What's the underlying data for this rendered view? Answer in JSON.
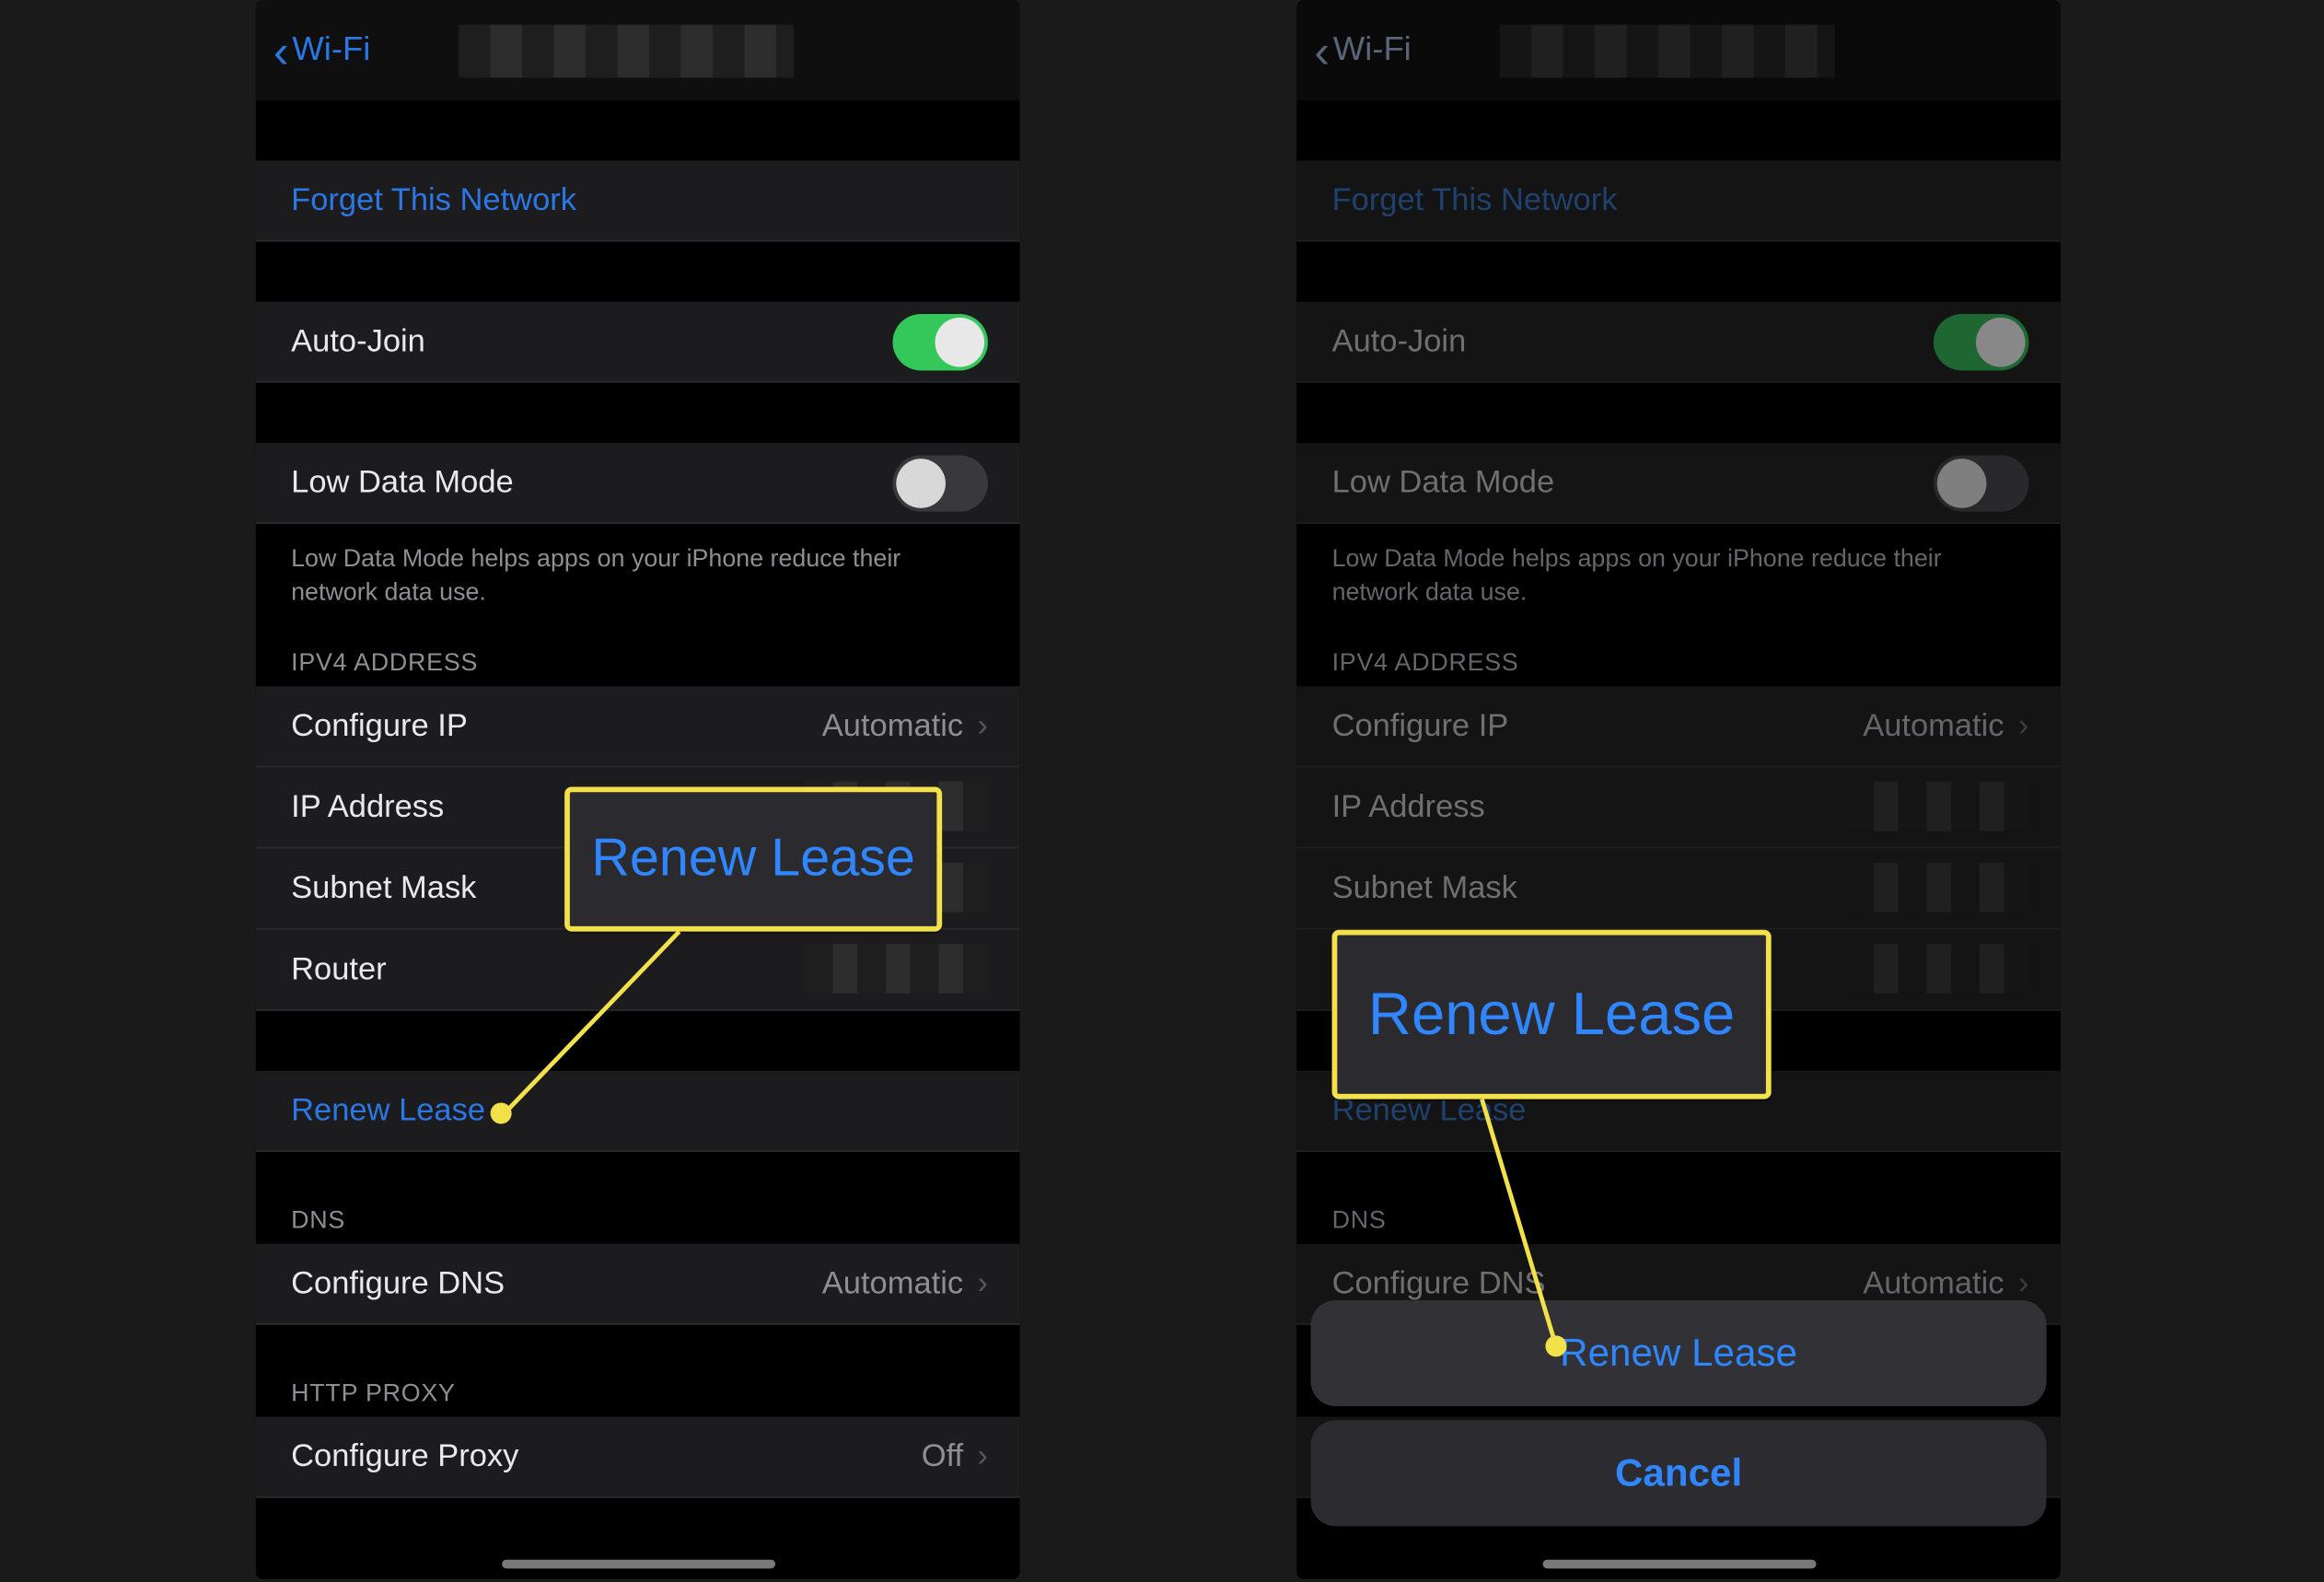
{
  "nav": {
    "back_label": "Wi-Fi"
  },
  "actions": {
    "forget": "Forget This Network",
    "renew": "Renew Lease"
  },
  "auto_join": {
    "label": "Auto-Join",
    "on": true
  },
  "low_data": {
    "label": "Low Data Mode",
    "on": false,
    "note": "Low Data Mode helps apps on your iPhone reduce their network data use."
  },
  "headers": {
    "ipv4": "IPV4 ADDRESS",
    "dns": "DNS",
    "proxy": "HTTP PROXY"
  },
  "ipv4": {
    "configure_label": "Configure IP",
    "configure_value": "Automatic",
    "ip_label": "IP Address",
    "subnet_label": "Subnet Mask",
    "router_label": "Router"
  },
  "dns": {
    "configure_label": "Configure DNS",
    "configure_value": "Automatic"
  },
  "proxy": {
    "configure_label": "Configure Proxy",
    "configure_value": "Off"
  },
  "callouts": {
    "left": "Renew Lease",
    "right": "Renew Lease"
  },
  "sheet": {
    "renew": "Renew Lease",
    "cancel": "Cancel"
  },
  "colors": {
    "accent": "#2b78e4",
    "highlight": "#f2e14a",
    "toggle_on": "#34c759"
  }
}
